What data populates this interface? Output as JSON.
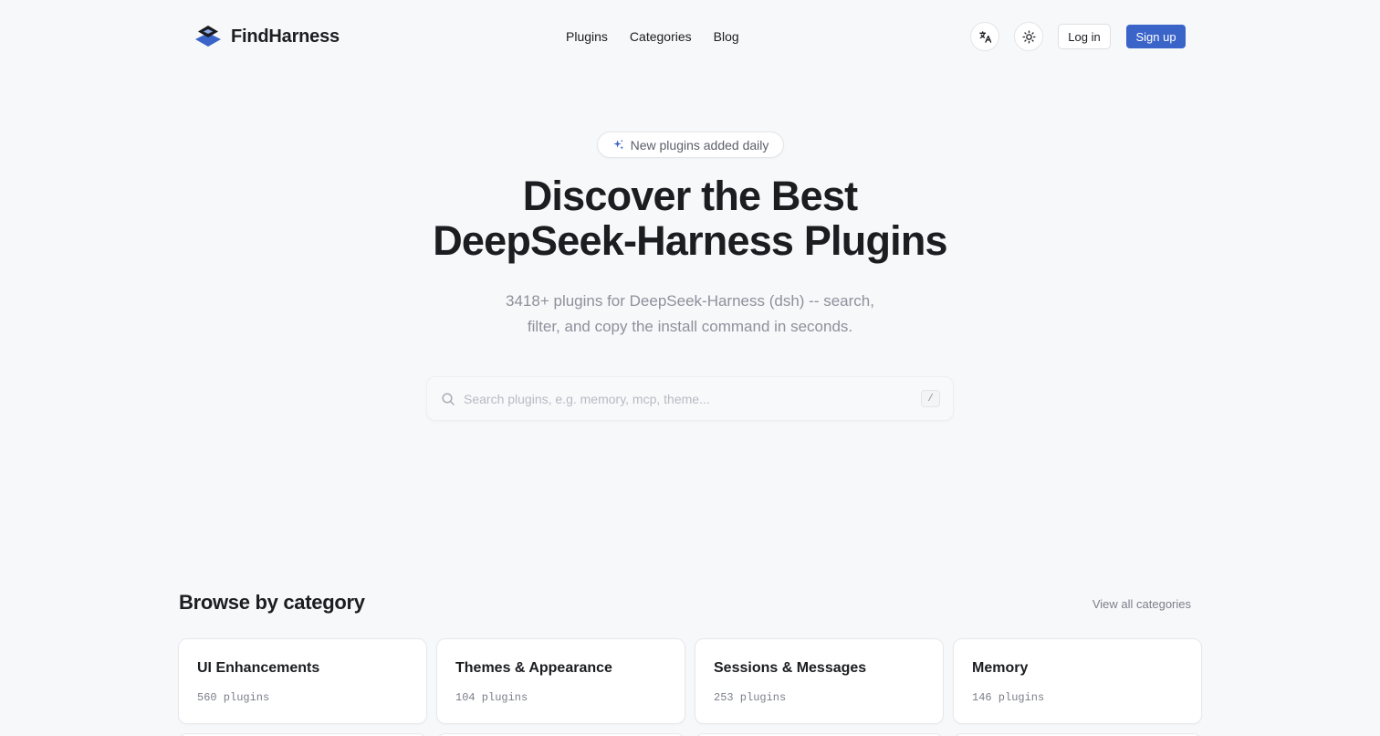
{
  "brand": {
    "name": "FindHarness",
    "logo_icon": "stacked-diamond-logo",
    "accent_color": "#3b64c9"
  },
  "nav": {
    "items": [
      "Plugins",
      "Categories",
      "Blog"
    ]
  },
  "header_actions": {
    "translate_icon": "translate-icon",
    "theme_icon": "sun-icon",
    "login_label": "Log in",
    "signup_label": "Sign up"
  },
  "hero": {
    "badge_icon": "sparkle-icon",
    "badge_text": "New plugins added daily",
    "title_line1": "Discover the Best",
    "title_line2": "DeepSeek-Harness Plugins",
    "subtitle_line1": "3418+ plugins for DeepSeek-Harness (dsh) -- search,",
    "subtitle_line2": "filter, and copy the install command in seconds."
  },
  "search": {
    "placeholder": "Search plugins, e.g. memory, mcp, theme...",
    "value": "",
    "shortcut": "/"
  },
  "categories": {
    "title": "Browse by category",
    "view_all_label": "View all categories",
    "items": [
      {
        "name": "UI Enhancements",
        "count": "560 plugins"
      },
      {
        "name": "Themes & Appearance",
        "count": "104 plugins"
      },
      {
        "name": "Sessions & Messages",
        "count": "253 plugins"
      },
      {
        "name": "Memory",
        "count": "146 plugins"
      }
    ]
  }
}
